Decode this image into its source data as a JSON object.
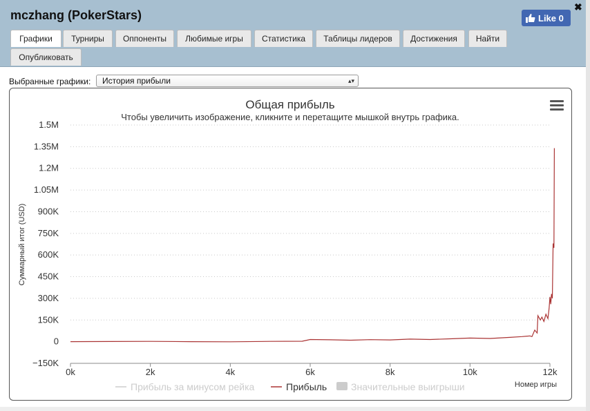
{
  "window": {
    "title": "mczhang (PokerStars)",
    "close_symbol": "✖"
  },
  "facebook": {
    "label": "Like 0"
  },
  "tabs": [
    {
      "label": "Графики",
      "active": true
    },
    {
      "label": "Турниры"
    },
    {
      "label": "Оппоненты"
    },
    {
      "label": "Любимые игры"
    },
    {
      "label": "Статистика"
    },
    {
      "label": "Таблицы лидеров"
    },
    {
      "label": "Достижения"
    },
    {
      "label": "Найти"
    },
    {
      "label": "Опубликовать"
    }
  ],
  "selector": {
    "label": "Выбранные графики:",
    "value": "История прибыли",
    "arrow": "▴▾"
  },
  "chart_data": {
    "type": "line",
    "title": "Общая прибыль",
    "subtitle": "Чтобы увеличить изображение, кликните и перетащите мышкой внутрь графика.",
    "xlabel": "Номер игры",
    "ylabel": "Суммарный итог (USD)",
    "xlim": [
      0,
      12000
    ],
    "ylim": [
      -150000,
      1500000
    ],
    "grid": true,
    "legend_position": "bottom-center",
    "x_ticks": [
      {
        "v": 0,
        "label": "0k"
      },
      {
        "v": 2000,
        "label": "2k"
      },
      {
        "v": 4000,
        "label": "4k"
      },
      {
        "v": 6000,
        "label": "6k"
      },
      {
        "v": 8000,
        "label": "8k"
      },
      {
        "v": 10000,
        "label": "10k"
      },
      {
        "v": 12000,
        "label": "12k"
      }
    ],
    "y_ticks": [
      {
        "v": 1500000,
        "label": "1.5M"
      },
      {
        "v": 1350000,
        "label": "1.35M"
      },
      {
        "v": 1200000,
        "label": "1.2M"
      },
      {
        "v": 1050000,
        "label": "1.05M"
      },
      {
        "v": 900000,
        "label": "900K"
      },
      {
        "v": 750000,
        "label": "750K"
      },
      {
        "v": 600000,
        "label": "600K"
      },
      {
        "v": 450000,
        "label": "450K"
      },
      {
        "v": 300000,
        "label": "300K"
      },
      {
        "v": 150000,
        "label": "150K"
      },
      {
        "v": 0,
        "label": "0"
      },
      {
        "v": -150000,
        "label": "−150K"
      }
    ],
    "legend": [
      {
        "name": "Прибыль за минусом рейка",
        "color": "#cccccc",
        "symbol": "line",
        "hidden": true
      },
      {
        "name": "Прибыль",
        "color": "#aa3333",
        "symbol": "line",
        "hidden": false
      },
      {
        "name": "Значительные выигрыши",
        "color": "#cccccc",
        "symbol": "box",
        "hidden": true
      }
    ],
    "series": [
      {
        "name": "Прибыль",
        "color": "#aa3333",
        "x": [
          0,
          1000,
          2000,
          3000,
          4000,
          5000,
          5800,
          6000,
          6500,
          7000,
          7500,
          8000,
          8500,
          9000,
          9500,
          10000,
          10500,
          11000,
          11300,
          11500,
          11550,
          11620,
          11680,
          11700,
          11760,
          11800,
          11850,
          11900,
          11950,
          11980,
          12000,
          12020,
          12040,
          12060,
          12080,
          12100,
          12110
        ],
        "y": [
          0,
          1000,
          2000,
          0,
          -1000,
          2000,
          3000,
          15000,
          13000,
          10000,
          14000,
          12000,
          18000,
          15000,
          20000,
          25000,
          22000,
          30000,
          35000,
          40000,
          35000,
          80000,
          60000,
          180000,
          150000,
          170000,
          140000,
          190000,
          160000,
          230000,
          310000,
          260000,
          330000,
          300000,
          680000,
          650000,
          1340000
        ]
      }
    ]
  }
}
